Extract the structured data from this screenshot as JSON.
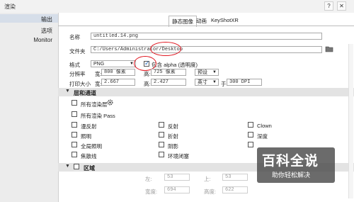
{
  "window": {
    "title": "渲染"
  },
  "sidebar": {
    "items": [
      {
        "label": "输出"
      },
      {
        "label": "选项"
      },
      {
        "label": "Monitor"
      }
    ]
  },
  "tabs": [
    {
      "label": "静态图像"
    },
    {
      "label": "动画"
    },
    {
      "label": "KeyShotXR"
    }
  ],
  "output": {
    "name_label": "名称",
    "name_value": "untitled.14.png",
    "folder_label": "文件夹",
    "folder_value": "C:/Users/Administrator/Desktop",
    "format_label": "格式",
    "format_value": "PNG",
    "alpha_label": "包含 alpha (透明度)",
    "resolution_label": "分辨率",
    "width_label": "宽:",
    "width_value": "800 像素",
    "height_label": "高:",
    "height_value": "725 像素",
    "preset_value": "预设",
    "print_label": "打印大小",
    "print_width_value": "2.667",
    "print_height_value": "2.427",
    "unit_value": "英寸",
    "at_label": "于",
    "dpi_value": "300 DPI"
  },
  "layers": {
    "title": "层和通道",
    "all_passes": "所有渲染层",
    "all_render_passes": "所有渲染 Pass",
    "items": [
      "漫反射",
      "反射",
      "Clown",
      "照明",
      "折射",
      "深度",
      "全局照明",
      "阴影",
      "",
      "焦散线",
      "环境闭塞",
      ""
    ]
  },
  "region": {
    "title": "区域",
    "x_label": "左:",
    "x_value": "53",
    "y_label": "上:",
    "y_value": "53",
    "w_label": "宽度:",
    "w_value": "694",
    "h_label": "高度:",
    "h_value": "622"
  },
  "watermark": {
    "main": "百科全说",
    "sub": "助你轻松解决"
  }
}
